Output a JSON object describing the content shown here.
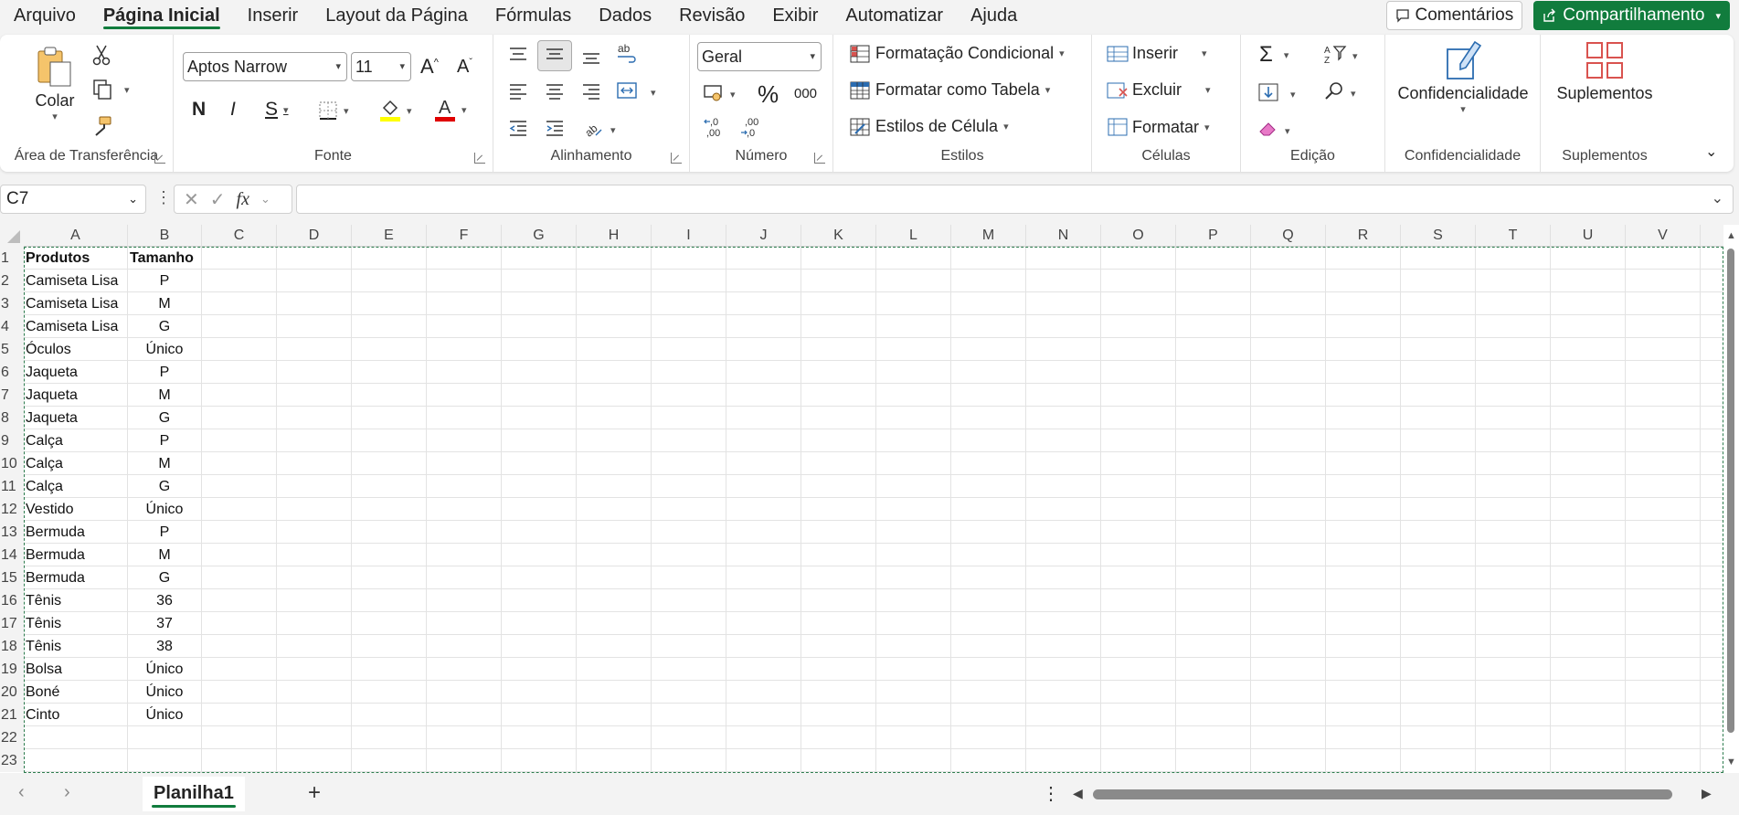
{
  "menu": {
    "items": [
      "Arquivo",
      "Página Inicial",
      "Inserir",
      "Layout da Página",
      "Fórmulas",
      "Dados",
      "Revisão",
      "Exibir",
      "Automatizar",
      "Ajuda"
    ],
    "active_index": 1,
    "comments_label": "Comentários",
    "share_label": "Compartilhamento"
  },
  "ribbon": {
    "clipboard": {
      "paste_label": "Colar",
      "group_label": "Área de Transferência"
    },
    "font": {
      "font_name": "Aptos Narrow",
      "font_size": "11",
      "bold": "N",
      "italic": "I",
      "underline": "S",
      "group_label": "Fonte",
      "highlight_color": "#ffff00",
      "font_color": "#e00000"
    },
    "alignment": {
      "group_label": "Alinhamento"
    },
    "number": {
      "format": "Geral",
      "percent": "%",
      "thousands": "000",
      "group_label": "Número"
    },
    "styles": {
      "conditional": "Formatação Condicional",
      "as_table": "Formatar como Tabela",
      "cell_styles": "Estilos de Célula",
      "group_label": "Estilos"
    },
    "cells": {
      "insert": "Inserir",
      "delete": "Excluir",
      "format": "Formatar",
      "group_label": "Células"
    },
    "editing": {
      "group_label": "Edição"
    },
    "sensitivity": {
      "label": "Confidencialidade",
      "group_label": "Confidencialidade"
    },
    "addins": {
      "label": "Suplementos",
      "group_label": "Suplementos"
    }
  },
  "formula_bar": {
    "name_box": "C7",
    "formula": ""
  },
  "columns": [
    "A",
    "B",
    "C",
    "D",
    "E",
    "F",
    "G",
    "H",
    "I",
    "J",
    "K",
    "L",
    "M",
    "N",
    "O",
    "P",
    "Q",
    "R",
    "S",
    "T",
    "U",
    "V"
  ],
  "rows": [
    "1",
    "2",
    "3",
    "4",
    "5",
    "6",
    "7",
    "8",
    "9",
    "10",
    "11",
    "12",
    "13",
    "14",
    "15",
    "16",
    "17",
    "18",
    "19",
    "20",
    "21",
    "22",
    "23"
  ],
  "cells": [
    [
      "Produtos",
      "Tamanho"
    ],
    [
      "Camiseta Lisa",
      "P"
    ],
    [
      "Camiseta Lisa",
      "M"
    ],
    [
      "Camiseta Lisa",
      "G"
    ],
    [
      "Óculos",
      "Único"
    ],
    [
      "Jaqueta",
      "P"
    ],
    [
      "Jaqueta",
      "M"
    ],
    [
      "Jaqueta",
      "G"
    ],
    [
      "Calça",
      "P"
    ],
    [
      "Calça",
      "M"
    ],
    [
      "Calça",
      "G"
    ],
    [
      "Vestido",
      "Único"
    ],
    [
      "Bermuda",
      "P"
    ],
    [
      "Bermuda",
      "M"
    ],
    [
      "Bermuda",
      "G"
    ],
    [
      "Tênis",
      "36"
    ],
    [
      "Tênis",
      "37"
    ],
    [
      "Tênis",
      "38"
    ],
    [
      "Bolsa",
      "Único"
    ],
    [
      "Boné",
      "Único"
    ],
    [
      "Cinto",
      "Único"
    ]
  ],
  "sheet": {
    "tab_name": "Planilha1",
    "add_label": "+"
  },
  "colors": {
    "accent": "#117c3d"
  }
}
